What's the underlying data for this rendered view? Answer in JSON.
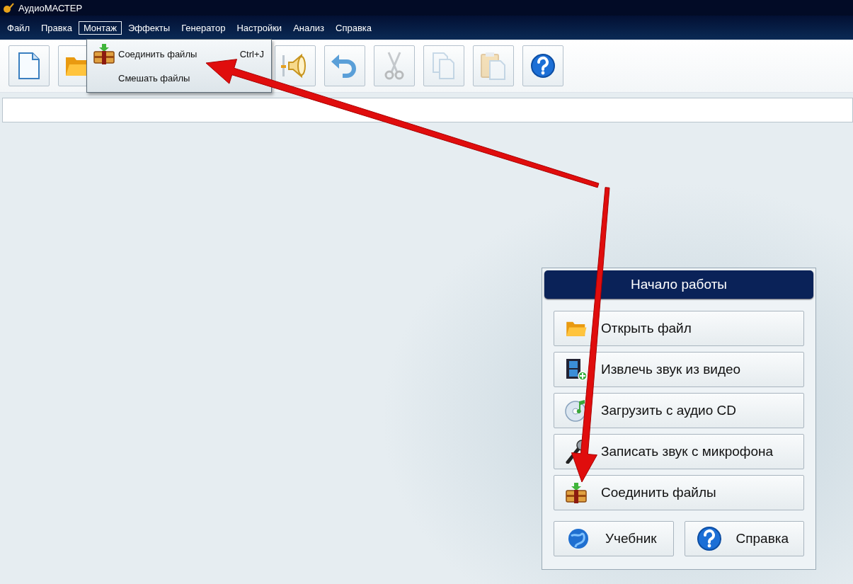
{
  "window": {
    "title": "АудиоМАСТЕР"
  },
  "menu_bar": [
    {
      "label": "Файл",
      "selected": false
    },
    {
      "label": "Правка",
      "selected": false
    },
    {
      "label": "Монтаж",
      "selected": true
    },
    {
      "label": "Эффекты",
      "selected": false
    },
    {
      "label": "Генератор",
      "selected": false
    },
    {
      "label": "Настройки",
      "selected": false
    },
    {
      "label": "Анализ",
      "selected": false
    },
    {
      "label": "Справка",
      "selected": false
    }
  ],
  "toolbar": [
    {
      "disabled": false
    },
    {
      "disabled": false
    },
    {
      "disabled": false
    },
    {
      "disabled": false
    },
    {
      "disabled": true
    },
    {
      "disabled": true
    },
    {
      "disabled": true
    },
    {
      "disabled": false
    }
  ],
  "dropdown": {
    "items": [
      {
        "label": "Соединить файлы",
        "shortcut": "Ctrl+J"
      },
      {
        "label": "Смешать файлы"
      }
    ]
  },
  "start_panel": {
    "title": "Начало работы",
    "actions": [
      {
        "label": "Открыть файл"
      },
      {
        "label": "Извлечь звук из видео"
      },
      {
        "label": "Загрузить с аудио CD"
      },
      {
        "label": "Записать звук с микрофона"
      },
      {
        "label": "Соединить файлы"
      }
    ],
    "footer_buttons": [
      {
        "label": "Учебник"
      },
      {
        "label": "Справка"
      }
    ]
  }
}
